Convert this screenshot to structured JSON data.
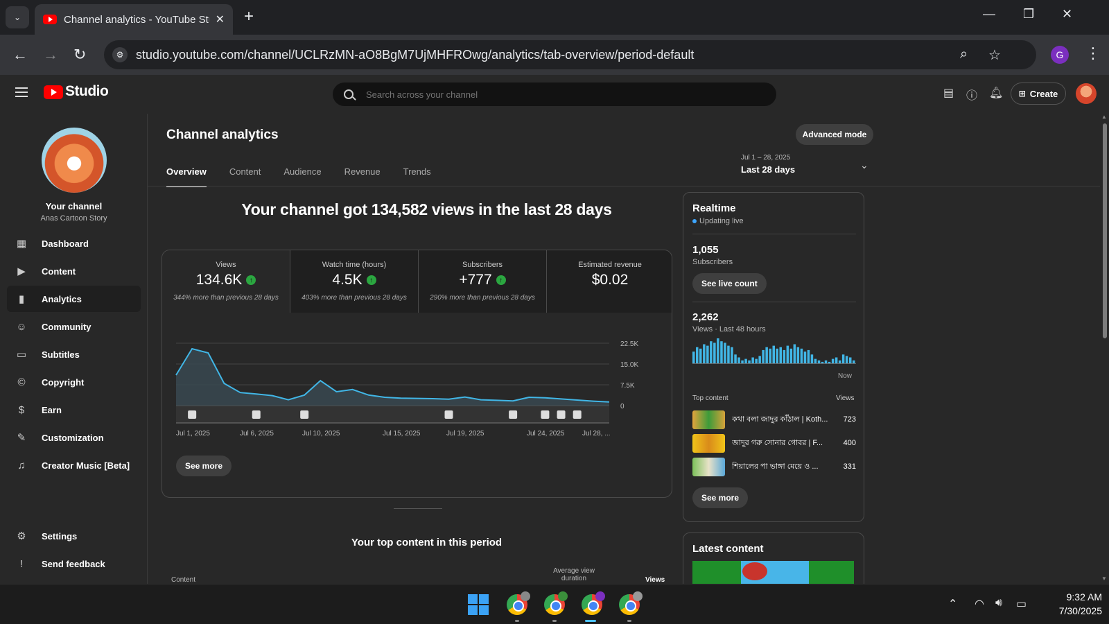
{
  "browser": {
    "tab_title": "Channel analytics - YouTube Studio",
    "url": "studio.youtube.com/channel/UCLRzMN-aO8BgM7UjMHFROwg/analytics/tab-overview/period-default",
    "profile_initial": "G"
  },
  "header": {
    "logo_text": "Studio",
    "search_placeholder": "Search across your channel",
    "create_label": "Create"
  },
  "sidebar": {
    "channel_title": "Your channel",
    "channel_name": "Anas Cartoon Story",
    "items": [
      {
        "label": "Dashboard",
        "icon": "dashboard-icon"
      },
      {
        "label": "Content",
        "icon": "content-icon"
      },
      {
        "label": "Analytics",
        "icon": "analytics-icon",
        "active": true
      },
      {
        "label": "Community",
        "icon": "community-icon"
      },
      {
        "label": "Subtitles",
        "icon": "subtitles-icon"
      },
      {
        "label": "Copyright",
        "icon": "copyright-icon"
      },
      {
        "label": "Earn",
        "icon": "earn-icon"
      },
      {
        "label": "Customization",
        "icon": "customization-icon"
      },
      {
        "label": "Creator Music [Beta]",
        "icon": "music-icon"
      }
    ],
    "bottom_items": [
      {
        "label": "Settings",
        "icon": "settings-icon"
      },
      {
        "label": "Send feedback",
        "icon": "feedback-icon"
      }
    ]
  },
  "main": {
    "title": "Channel analytics",
    "advanced_mode": "Advanced mode",
    "tabs": [
      "Overview",
      "Content",
      "Audience",
      "Revenue",
      "Trends"
    ],
    "period_range": "Jul 1 – 28, 2025",
    "period_label": "Last 28 days",
    "headline": "Your channel got 134,582 views in the last 28 days",
    "metrics": [
      {
        "title": "Views",
        "value": "134.6K",
        "delta": "344% more than previous 28 days",
        "up": true
      },
      {
        "title": "Watch time (hours)",
        "value": "4.5K",
        "delta": "403% more than previous 28 days",
        "up": true
      },
      {
        "title": "Subscribers",
        "value": "+777",
        "delta": "290% more than previous 28 days",
        "up": true
      },
      {
        "title": "Estimated revenue",
        "value": "$0.02",
        "delta": "",
        "up": false
      }
    ],
    "see_more": "See more",
    "top_content_title": "Your top content in this period",
    "table_headers": {
      "content": "Content",
      "avg_view_duration": "Average view duration",
      "views": "Views"
    }
  },
  "chart_data": {
    "type": "area",
    "title": "",
    "xlabel": "",
    "ylabel": "",
    "x_tick_labels": [
      "Jul 1, 2025",
      "Jul 6, 2025",
      "Jul 10, 2025",
      "Jul 15, 2025",
      "Jul 19, 2025",
      "Jul 24, 2025",
      "Jul 28, ..."
    ],
    "y_tick_labels": [
      "22.5K",
      "15.0K",
      "7.5K",
      "0"
    ],
    "ylim": [
      0,
      22500
    ],
    "x": [
      1,
      2,
      3,
      4,
      5,
      6,
      7,
      8,
      9,
      10,
      11,
      12,
      13,
      14,
      15,
      16,
      17,
      18,
      19,
      20,
      21,
      22,
      23,
      24,
      25,
      26,
      27,
      28
    ],
    "values": [
      11000,
      20500,
      19000,
      8000,
      4700,
      4200,
      3600,
      2100,
      3800,
      9000,
      5000,
      5800,
      3800,
      3000,
      2700,
      2600,
      2500,
      2300,
      3100,
      2100,
      1900,
      1700,
      3000,
      2800,
      2400,
      2000,
      1600,
      1300
    ],
    "video_marker_days": [
      2,
      6,
      9,
      18,
      22,
      24,
      25,
      26
    ],
    "grid": true,
    "color": "#41b6e6"
  },
  "realtime": {
    "title": "Realtime",
    "status": "Updating live",
    "subscribers_value": "1,055",
    "subscribers_label": "Subscribers",
    "see_live_count": "See live count",
    "views_value": "2,262",
    "views_label": "Views · Last 48 hours",
    "now_label": "Now",
    "hourly_views": [
      16,
      22,
      20,
      26,
      24,
      30,
      28,
      34,
      30,
      28,
      24,
      22,
      12,
      8,
      4,
      6,
      4,
      8,
      6,
      10,
      18,
      22,
      20,
      24,
      20,
      22,
      18,
      24,
      20,
      26,
      22,
      20,
      16,
      18,
      12,
      6,
      4,
      2,
      4,
      2,
      6,
      8,
      4,
      12,
      10,
      8,
      4
    ],
    "top_content_label": "Top content",
    "views_col_label": "Views",
    "top_content": [
      {
        "title": "কথা বলা জাদুর কাঁঠাল | Koth...",
        "views": "723"
      },
      {
        "title": "জাদুর গরু সোনার গোবর | F...",
        "views": "400"
      },
      {
        "title": "শিয়ালের পা ভাঙ্গা মেয়ে ও ...",
        "views": "331"
      }
    ],
    "see_more": "See more"
  },
  "latest_content": {
    "title": "Latest content"
  },
  "taskbar": {
    "time": "9:32 AM",
    "date": "7/30/2025"
  }
}
